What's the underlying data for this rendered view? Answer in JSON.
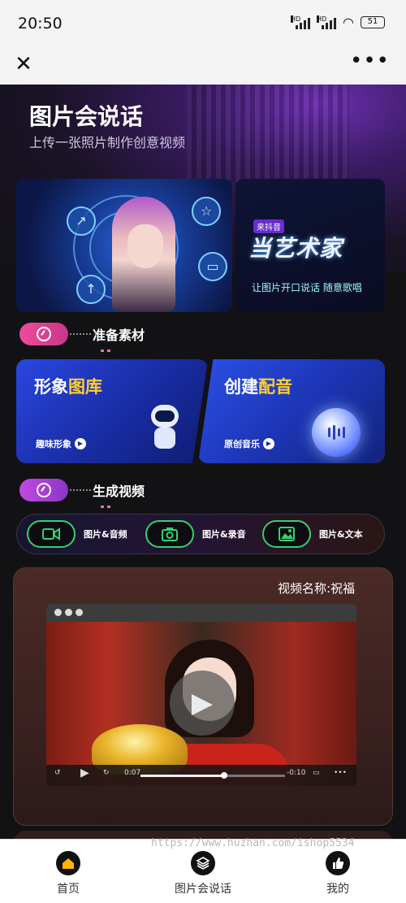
{
  "status": {
    "time": "20:50",
    "network1": "HD",
    "network2": "HD",
    "battery": "51"
  },
  "hero": {
    "title": "图片会说话",
    "subtitle": "上传一张照片制作创意视频"
  },
  "banner": {
    "right_tag": "来抖音",
    "right_title": "当艺术家",
    "right_subtitle": "让图片开口说话  随意歌唱"
  },
  "sections": {
    "prepare": "准备素材",
    "generate": "生成视频"
  },
  "features": {
    "gallery_title_a": "形象",
    "gallery_title_b": "图库",
    "gallery_sub": "趣味形象",
    "dub_title_a": "创建",
    "dub_title_b": "配音",
    "dub_sub": "原创音乐"
  },
  "actions": [
    {
      "label": "图片&音频",
      "icon": "video-camera-icon"
    },
    {
      "label": "图片&录音",
      "icon": "camera-icon"
    },
    {
      "label": "图片&文本",
      "icon": "image-icon"
    }
  ],
  "video": {
    "name": "视频名称:祝福",
    "time_current": "0:07",
    "time_total": "-0:10",
    "progress": 0.58
  },
  "watermark": "https://www.huzhan.com/ishop5534",
  "tabs": [
    {
      "label": "首页",
      "icon": "home-icon"
    },
    {
      "label": "图片会说话",
      "icon": "layers-icon"
    },
    {
      "label": "我的",
      "icon": "thumbs-up-icon"
    }
  ],
  "colors": {
    "accent_yellow": "#ffcf2e",
    "accent_green": "#36d070",
    "pill_pink": "#e0409a",
    "pill_purple": "#a24ad8"
  }
}
